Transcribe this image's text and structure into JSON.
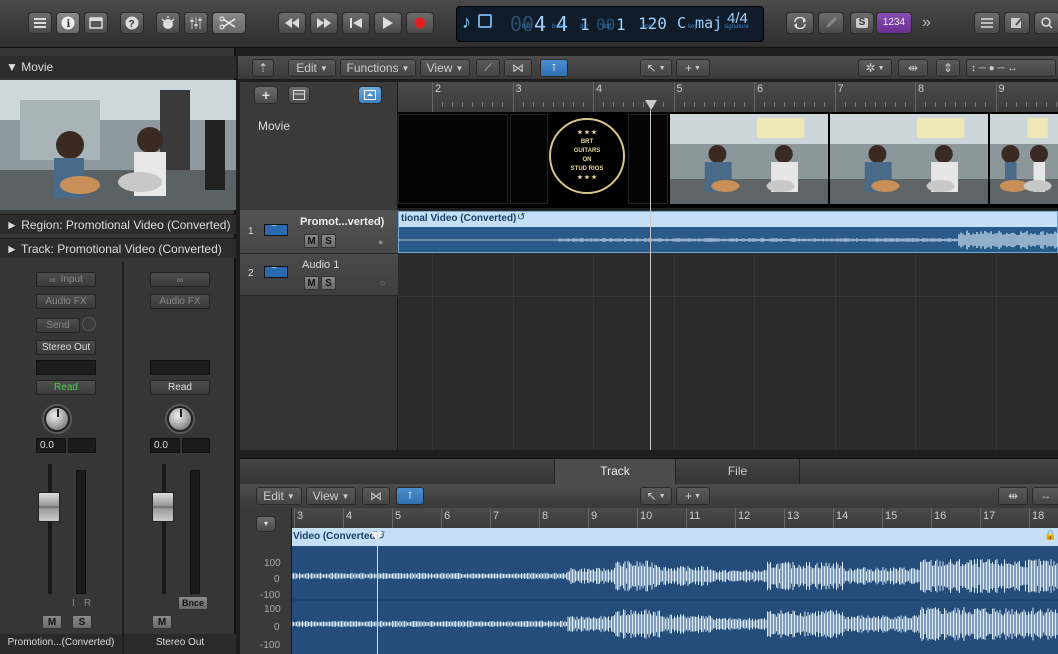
{
  "lcd": {
    "bar": "4",
    "beat": "4",
    "div": "1",
    "tick": "1",
    "bar_ghost": "00",
    "tick_ghost": "00",
    "bpm": "120",
    "key": "C maj",
    "signature": "4/4",
    "bar_label": "bar",
    "beat_label": "beat",
    "div_label": "div",
    "tick_label": "tick",
    "bpm_label": "bpm",
    "key_label": "key",
    "sig_label": "signature"
  },
  "right_toolbar": {
    "solo_label": "S",
    "count_in": "1234"
  },
  "movie": {
    "header": "▼ Movie"
  },
  "inspector": {
    "region_label": "► Region: Promotional Video (Converted)",
    "track_label": "► Track: Promotional Video (Converted)"
  },
  "strip1": {
    "input": "Input",
    "audio_fx": "Audio FX",
    "send": "Send",
    "output": "Stereo Out",
    "automation": "Read",
    "volume": "0.0",
    "i_label": "I",
    "r_label": "R",
    "mute": "M",
    "solo": "S",
    "name": "Promotion...(Converted)"
  },
  "strip2": {
    "audio_fx": "Audio FX",
    "automation": "Read",
    "volume": "0.0",
    "bounce": "Bnce",
    "mute": "M",
    "name": "Stereo Out"
  },
  "tracks_toolbar": {
    "edit": "Edit",
    "functions": "Functions",
    "view": "View"
  },
  "tracks_ruler": [
    {
      "n": "2"
    },
    {
      "n": "3"
    },
    {
      "n": "4"
    },
    {
      "n": "5"
    },
    {
      "n": "6"
    },
    {
      "n": "7"
    },
    {
      "n": "8"
    },
    {
      "n": "9"
    }
  ],
  "movie_track": {
    "label": "Movie",
    "logo_lines": [
      "★ ★ ★",
      "BRT",
      "GUITARS",
      "ON",
      "STUD RIOS",
      "★ ★ ★"
    ]
  },
  "tracks": [
    {
      "num": "1",
      "name": "Promot...verted)",
      "mute": "M",
      "solo": "S"
    },
    {
      "num": "2",
      "name": "Audio 1",
      "mute": "M",
      "solo": "S"
    }
  ],
  "region1": {
    "title": "tional Video (Converted)"
  },
  "editor": {
    "tab_track": "Track",
    "tab_file": "File",
    "edit": "Edit",
    "view": "View",
    "region_title": "Video (Converted)"
  },
  "editor_ruler": [
    {
      "n": "3"
    },
    {
      "n": "4"
    },
    {
      "n": "5"
    },
    {
      "n": "6"
    },
    {
      "n": "7"
    },
    {
      "n": "8"
    },
    {
      "n": "9"
    },
    {
      "n": "10"
    },
    {
      "n": "11"
    },
    {
      "n": "12"
    },
    {
      "n": "13"
    },
    {
      "n": "14"
    },
    {
      "n": "15"
    },
    {
      "n": "16"
    },
    {
      "n": "17"
    },
    {
      "n": "18"
    }
  ],
  "amp_scale": {
    "top1": "100",
    "mid1": "0",
    "bot1": "-100",
    "top2": "100",
    "mid2": "0",
    "bot2": "-100"
  },
  "colors": {
    "accent_blue": "#4a8fd0",
    "region_header": "#b8d9f4",
    "region_body": "#2b5a8a",
    "waveform": "#d7e9f7",
    "record_red": "#e02020",
    "purple": "#7b3fa0"
  }
}
